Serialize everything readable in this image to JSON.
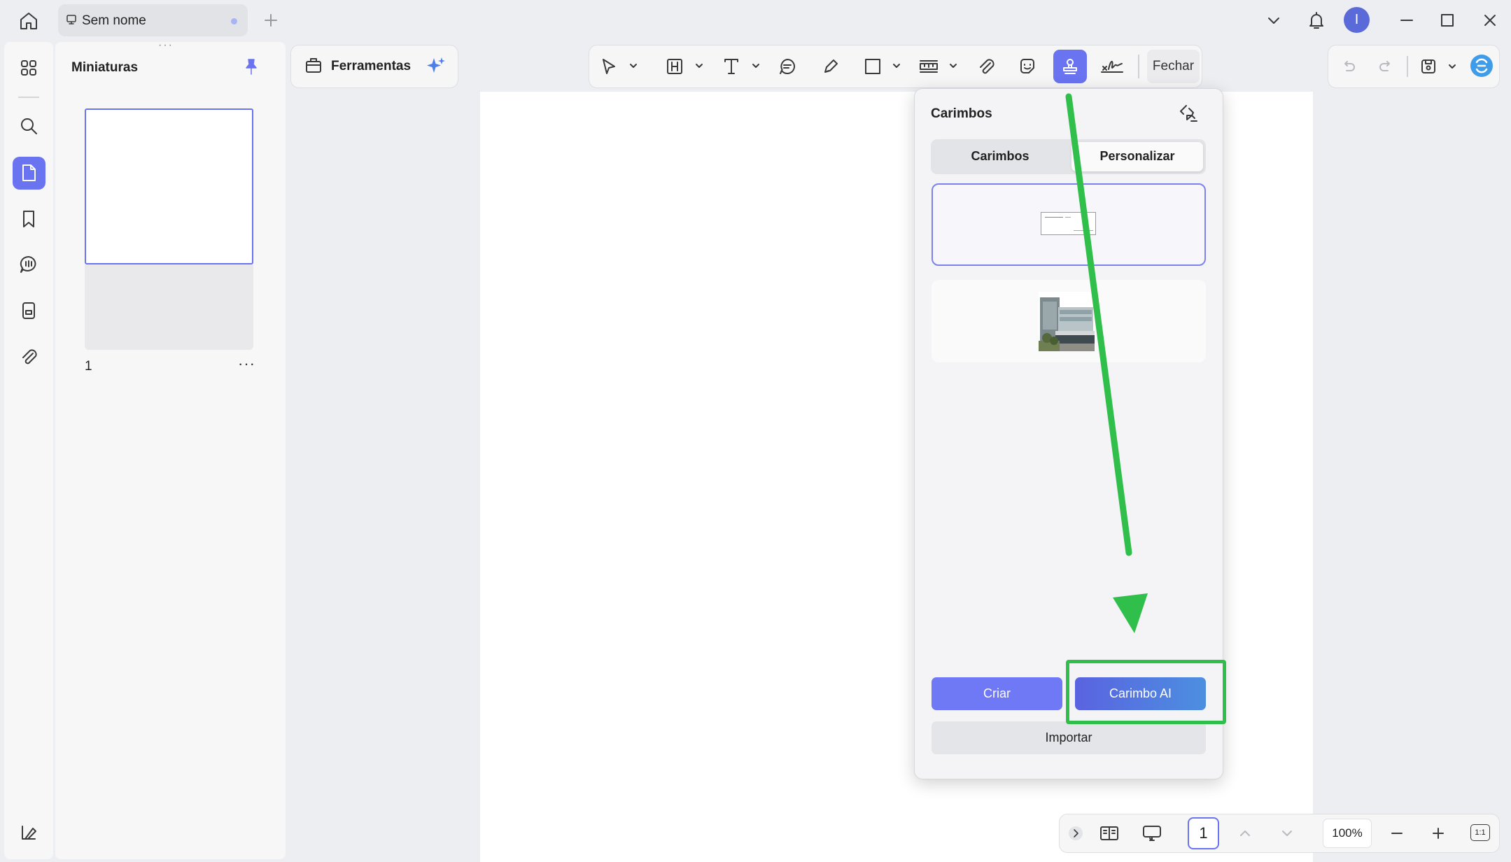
{
  "tab": {
    "title": "Sem nome"
  },
  "user": {
    "initial": "I"
  },
  "panel": {
    "title": "Miniaturas",
    "page_number": "1"
  },
  "toolbar": {
    "tools_label": "Ferramentas",
    "close_label": "Fechar"
  },
  "stamps": {
    "title": "Carimbos",
    "tabs": [
      {
        "label": "Carimbos"
      },
      {
        "label": "Personalizar"
      }
    ],
    "create_label": "Criar",
    "ai_label": "Carimbo AI",
    "import_label": "Importar"
  },
  "status": {
    "page": "1",
    "zoom": "100%",
    "fit_label": "1:1"
  },
  "colors": {
    "accent": "#6a73f0",
    "highlight": "#2fbf4a"
  }
}
